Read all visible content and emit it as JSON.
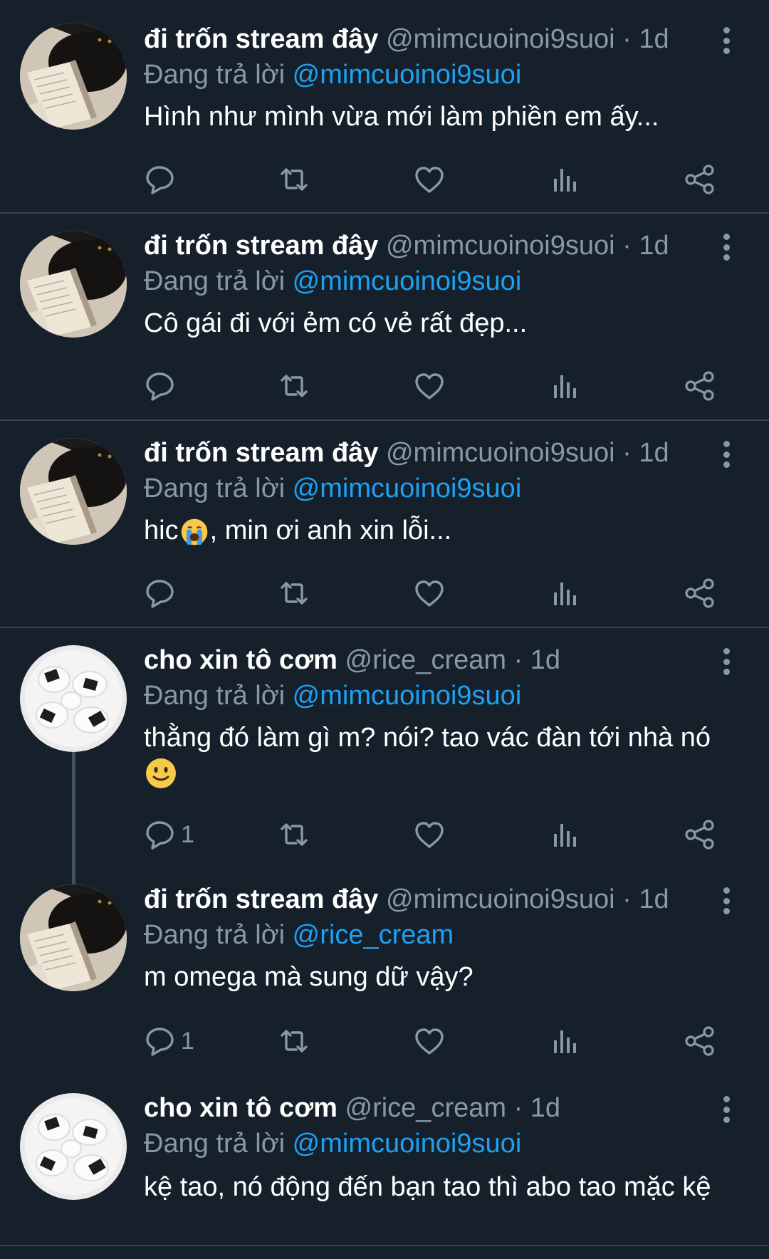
{
  "labels": {
    "reply_prefix": "Đang trả lời",
    "time_separator": "·"
  },
  "tweets": [
    {
      "name": "đi trốn stream đây",
      "handle": "@mimcuoinoi9suoi",
      "time": "1d",
      "reply_to": "@mimcuoinoi9suoi",
      "text": "Hình như mình vừa mới làm phiền em ấy...",
      "reply_count": "",
      "avatar": "cat-with-book"
    },
    {
      "name": "đi trốn stream đây",
      "handle": "@mimcuoinoi9suoi",
      "time": "1d",
      "reply_to": "@mimcuoinoi9suoi",
      "text": "Cô gái đi với ẻm có vẻ rất đẹp...",
      "reply_count": "",
      "avatar": "cat-with-book"
    },
    {
      "name": "đi trốn stream đây",
      "handle": "@mimcuoinoi9suoi",
      "time": "1d",
      "reply_to": "@mimcuoinoi9suoi",
      "text_before_emoji": "hic",
      "emoji": "loudly-crying-face",
      "text_after_emoji": ", min ơi anh xin lỗi...",
      "reply_count": "",
      "avatar": "cat-with-book"
    },
    {
      "name": "cho xin tô cơm",
      "handle": "@rice_cream",
      "time": "1d",
      "reply_to": "@mimcuoinoi9suoi",
      "text": "thằng đó làm gì m? nói? tao vác đàn tới nhà nó",
      "emoji": "slightly-smiling-face",
      "reply_count": "1",
      "avatar": "onigiri"
    },
    {
      "name": "đi trốn stream đây",
      "handle": "@mimcuoinoi9suoi",
      "time": "1d",
      "reply_to": "@rice_cream",
      "text": "m omega mà sung dữ vậy?",
      "reply_count": "1",
      "avatar": "cat-with-book"
    },
    {
      "name": "cho xin tô cơm",
      "handle": "@rice_cream",
      "time": "1d",
      "reply_to": "@mimcuoinoi9suoi",
      "text": "kệ tao, nó động đến bạn tao thì abo tao mặc kệ",
      "reply_count": "",
      "avatar": "onigiri"
    }
  ],
  "colors": {
    "background": "#15202b",
    "divider": "#38444d",
    "secondary_text": "#8899a6",
    "link": "#1da1f2",
    "thread_line": "#3d5466"
  },
  "icons": [
    "reply-icon",
    "retweet-icon",
    "like-icon",
    "views-icon",
    "share-icon",
    "more-icon"
  ]
}
